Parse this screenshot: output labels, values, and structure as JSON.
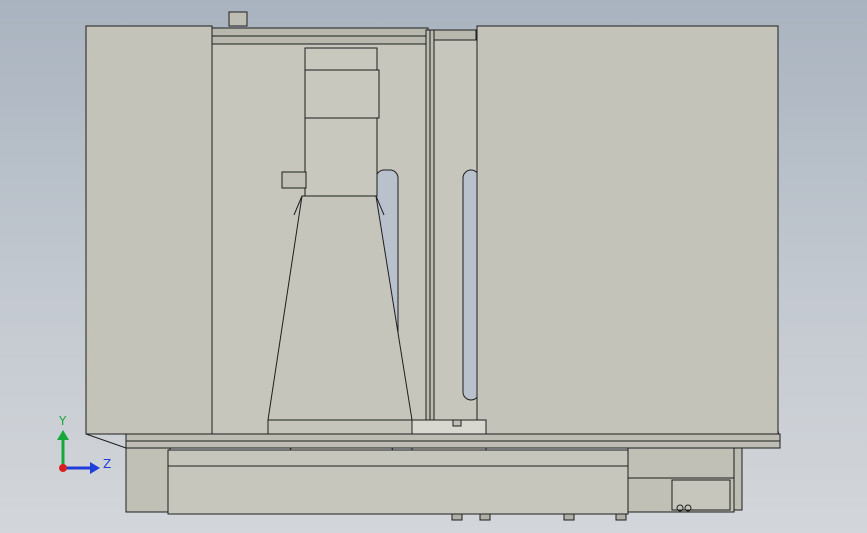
{
  "viewport": {
    "background_top": "#a9b3bf",
    "background_bottom": "#d3d6da"
  },
  "model": {
    "panel_color": "#c3c3ba",
    "edge_color": "#1e1e1e",
    "shadow_color": "#7d7d76",
    "glass_color": "#b9c1cc"
  },
  "triad": {
    "y_label": "Y",
    "z_label": "Z",
    "y_color": "#18a83a",
    "z_color": "#1f3fd8",
    "x_color": "#d81f1f"
  }
}
